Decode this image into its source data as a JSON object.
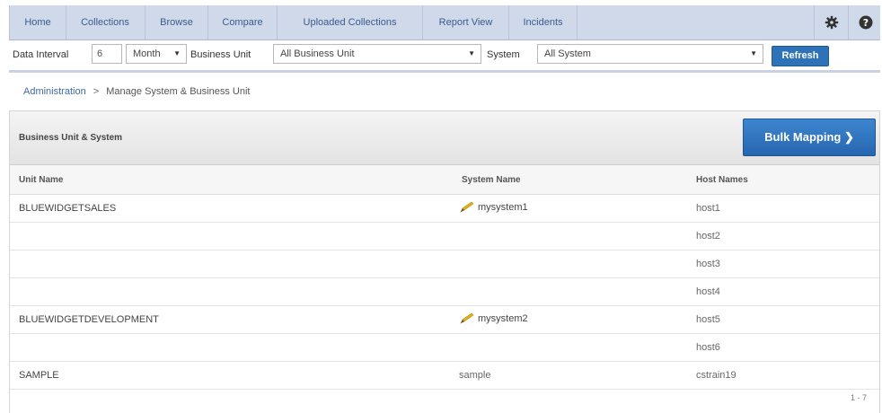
{
  "nav": {
    "items": [
      {
        "label": "Home"
      },
      {
        "label": "Collections"
      },
      {
        "label": "Browse"
      },
      {
        "label": "Compare"
      },
      {
        "label": "Uploaded Collections"
      },
      {
        "label": "Report View"
      },
      {
        "label": "Incidents"
      }
    ],
    "icons": {
      "settings": "gear-icon",
      "help": "help-icon"
    }
  },
  "filters": {
    "data_interval_label": "Data Interval",
    "data_interval_value": "6",
    "interval_unit": "Month",
    "business_unit_label": "Business Unit",
    "business_unit_value": "All Business Unit",
    "system_label": "System",
    "system_value": "All System",
    "refresh_label": "Refresh"
  },
  "breadcrumb": {
    "parent": "Administration",
    "separator": ">",
    "current": "Manage System & Business Unit"
  },
  "panel": {
    "title": "Business Unit & System",
    "bulk_label": "Bulk Mapping ❯",
    "columns": {
      "unit": "Unit Name",
      "system": "System Name",
      "host": "Host Names"
    },
    "rows": [
      {
        "unit": "BLUEWIDGETSALES",
        "system": "mysystem1",
        "editable": true,
        "host": "host1"
      },
      {
        "unit": "",
        "system": "",
        "editable": false,
        "host": "host2"
      },
      {
        "unit": "",
        "system": "",
        "editable": false,
        "host": "host3"
      },
      {
        "unit": "",
        "system": "",
        "editable": false,
        "host": "host4"
      },
      {
        "unit": "BLUEWIDGETDEVELOPMENT",
        "system": "mysystem2",
        "editable": true,
        "host": "host5"
      },
      {
        "unit": "",
        "system": "",
        "editable": false,
        "host": "host6"
      },
      {
        "unit": "SAMPLE",
        "system": "sample",
        "editable": false,
        "host": "cstrain19"
      }
    ],
    "pagination": "1 - 7"
  },
  "colors": {
    "nav_bg": "#cfd9ea",
    "accent": "#2e73b8",
    "pencil": "#e0b21b"
  }
}
